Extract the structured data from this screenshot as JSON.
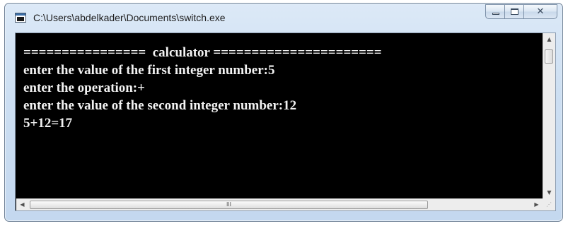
{
  "window": {
    "title": "C:\\Users\\abdelkader\\Documents\\switch.exe",
    "close_glyph": "✕"
  },
  "console": {
    "lines": [
      "================  calculator ======================",
      "enter the value of the first integer number:5",
      "enter the operation:+",
      "enter the value of the second integer number:12",
      "5+12=17"
    ]
  },
  "scrollbars": {
    "up_arrow": "▲",
    "down_arrow": "▼",
    "left_arrow": "◀",
    "right_arrow": "▶",
    "h_thumb_grip": "III",
    "size_grip": "⋰"
  }
}
